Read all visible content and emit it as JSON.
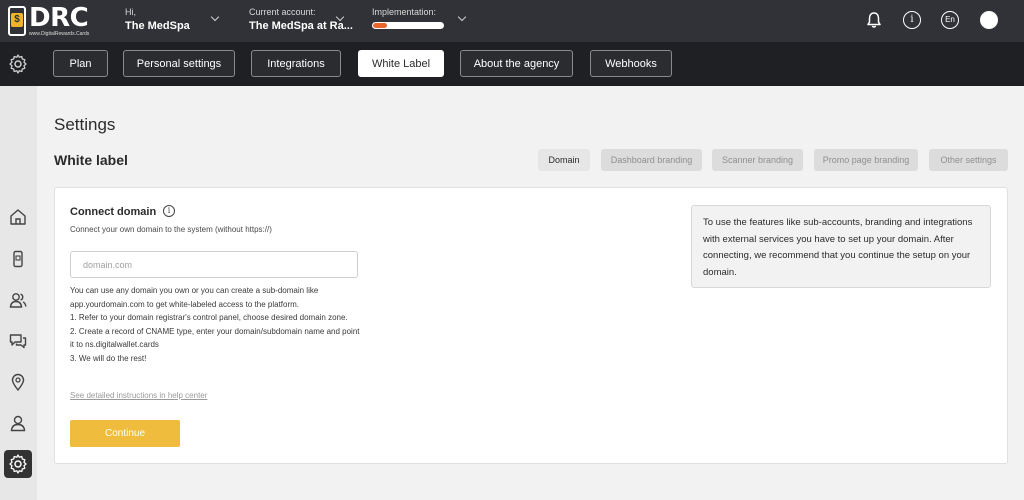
{
  "app": {
    "logo_text": "DRC",
    "logo_subtext": "www.DigitalRewards.Cards",
    "logo_icon": "phone-dollar-icon"
  },
  "topbar": {
    "greeting_label": "Hi,",
    "greeting_name": "The MedSpa",
    "account_label": "Current account:",
    "account_value": "The MedSpa at Ra...",
    "implementation_label": "Implementation:",
    "implementation_progress": 0.2,
    "implementation_color": "#e8662b",
    "language": "En",
    "icons": [
      "bell-icon",
      "info-icon",
      "language-icon",
      "avatar"
    ]
  },
  "nav": {
    "tabs": [
      {
        "label": "Plan",
        "active": false
      },
      {
        "label": "Personal settings",
        "active": false
      },
      {
        "label": "Integrations",
        "active": false
      },
      {
        "label": "White Label",
        "active": true
      },
      {
        "label": "About the agency",
        "active": false
      },
      {
        "label": "Webhooks",
        "active": false
      }
    ]
  },
  "sidebar": {
    "items": [
      "home-icon",
      "card-icon",
      "users-icon",
      "chat-icon",
      "location-icon",
      "user-icon",
      "gear-icon"
    ],
    "active": "gear-icon"
  },
  "page": {
    "title": "Settings",
    "section_title": "White label",
    "subtabs": [
      {
        "label": "Domain",
        "active": true
      },
      {
        "label": "Dashboard branding",
        "active": false
      },
      {
        "label": "Scanner branding",
        "active": false
      },
      {
        "label": "Promo page branding",
        "active": false
      },
      {
        "label": "Other settings",
        "active": false
      }
    ]
  },
  "domain_card": {
    "title": "Connect domain",
    "subtitle": "Connect your own domain to the system (without https://)",
    "input_value": "",
    "input_placeholder": "domain.com",
    "instructions": [
      "You can use any domain you own or you can create a sub-domain like app.yourdomain.com to get white-labeled access to the platform.",
      "1. Refer to your domain registrar's control panel, choose desired domain zone.",
      "2. Create a record of CNAME type, enter your domain/subdomain name and point it to ns.digitalwallet.cards",
      "3. We will do the rest!"
    ],
    "help_link": "See detailed instructions in help center",
    "continue_label": "Continue",
    "continue_color": "#efbc3e",
    "info_text": "To use the features like sub-accounts, branding and integrations with external services you have to set up your domain. After connecting, we recommend that you continue the setup on your domain."
  }
}
